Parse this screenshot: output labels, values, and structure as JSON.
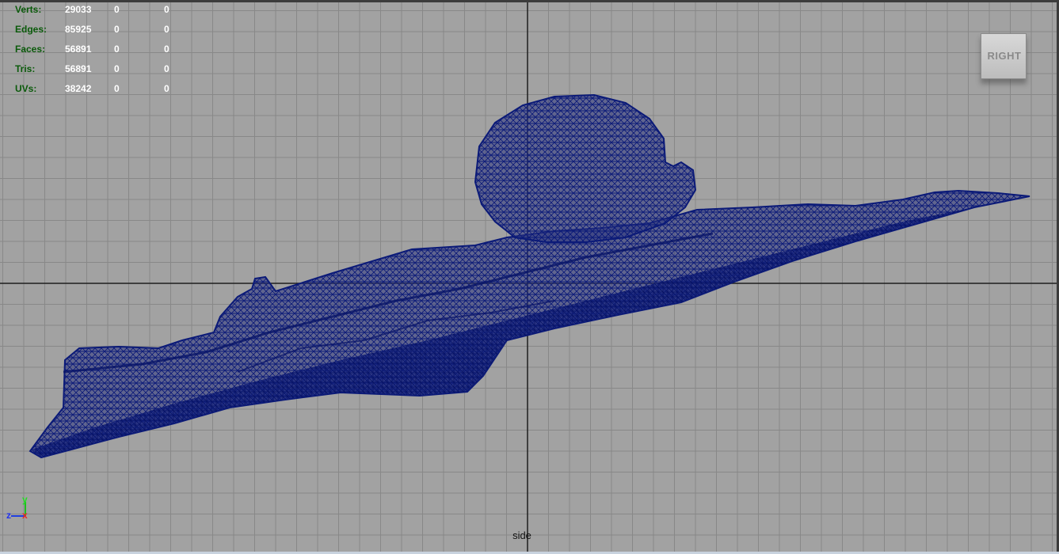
{
  "viewport": {
    "camera_name": "side",
    "view_cube_label": "RIGHT"
  },
  "hud": {
    "rows": [
      {
        "label": "Verts:",
        "v1": "29033",
        "v2": "0",
        "v3": "0"
      },
      {
        "label": "Edges:",
        "v1": "85925",
        "v2": "0",
        "v3": "0"
      },
      {
        "label": "Faces:",
        "v1": "56891",
        "v2": "0",
        "v3": "0"
      },
      {
        "label": "Tris:",
        "v1": "56891",
        "v2": "0",
        "v3": "0"
      },
      {
        "label": "UVs:",
        "v1": "38242",
        "v2": "0",
        "v3": "0"
      }
    ]
  },
  "axis": {
    "up": "y",
    "left": "z",
    "center": "x"
  },
  "colors": {
    "background": "#a2a2a2",
    "grid": "#888888",
    "grid_axis": "#1e1e1e",
    "wireframe": "#0b1a78",
    "hud_label": "#0a5a0a",
    "hud_value": "#ffffff"
  }
}
